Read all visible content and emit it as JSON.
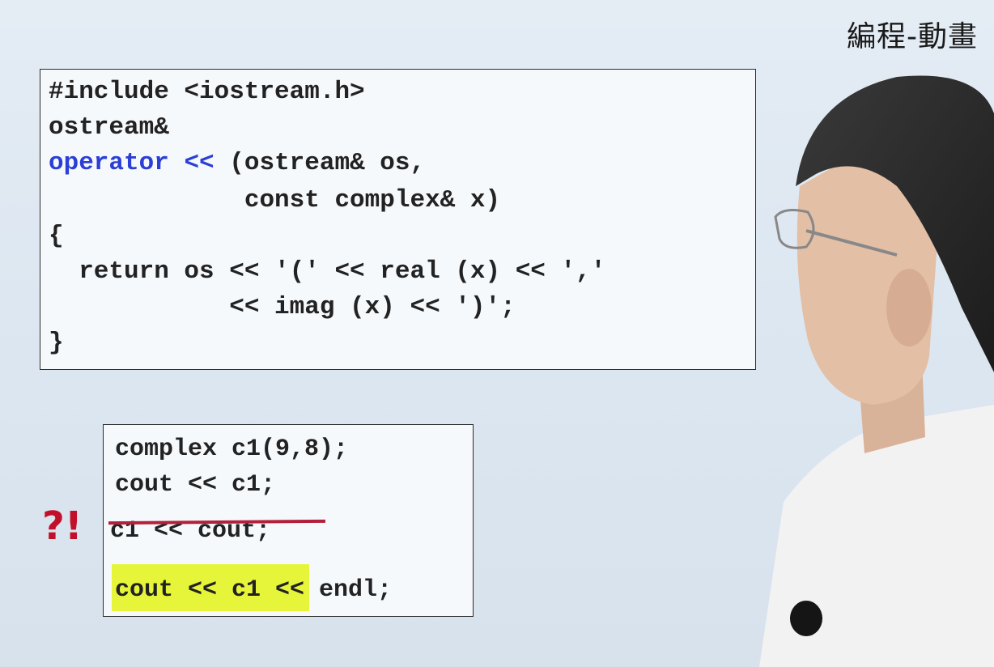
{
  "watermark": "編程-動畫",
  "main_code": {
    "lines": [
      "#include <iostream.h>",
      "ostream&",
      "operator << (ostream& os,",
      "             const complex& x)",
      "{",
      "  return os << '(' << real (x) << ','",
      "            << imag (x) << ')';",
      "}"
    ],
    "operator_keyword": "operator",
    "operator_symbol": "<<",
    "operator_rest": " (ostream& os,"
  },
  "usage_code": {
    "line1": "complex c1(9,8);",
    "line2": "cout << c1;",
    "struck": "c1 << cout;",
    "highlighted": "cout << c1",
    "tail": " << endl;"
  },
  "mark": "?!",
  "colors": {
    "keyword": "#2b3fd6",
    "strike": "#b3203c",
    "highlight": "#e6f53a",
    "mark": "#c2102a"
  }
}
